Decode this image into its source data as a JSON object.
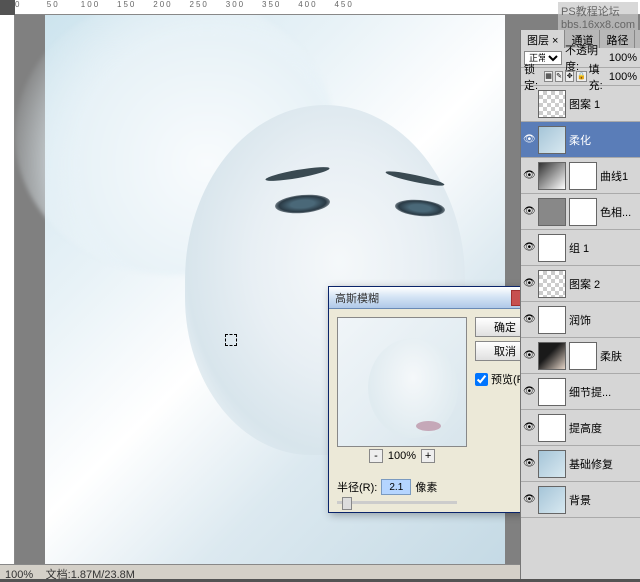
{
  "watermark": {
    "line1": "PS教程论坛",
    "line2": "bbs.16xx8.com"
  },
  "status": {
    "zoom": "100%",
    "doc": "文档:1.87M/23.8M"
  },
  "dialog": {
    "title": "高斯模糊",
    "ok": "确定",
    "cancel": "取消",
    "preview_label": "预览(P)",
    "zoom_minus": "-",
    "zoom_plus": "+",
    "zoom_value": "100%",
    "radius_label": "半径(R):",
    "radius_value": "2.1",
    "radius_unit": "像素"
  },
  "layers": {
    "tabs": {
      "t1": "图层 ×",
      "t2": "通道",
      "t3": "路径"
    },
    "blend": "正常",
    "opacity_label": "不透明度:",
    "opacity": "100%",
    "lock_label": "锁定:",
    "fill_label": "填充:",
    "fill": "100%",
    "items": [
      {
        "name": "图案 1",
        "thumb": "checker",
        "eye": false
      },
      {
        "name": "柔化",
        "thumb": "blue",
        "eye": true,
        "sel": true
      },
      {
        "name": "曲线1",
        "thumb": "grad",
        "mask": true,
        "eye": true
      },
      {
        "name": "色相...",
        "thumb": "gray",
        "mask": true,
        "eye": true
      },
      {
        "name": "组 1",
        "thumb": "",
        "eye": true
      },
      {
        "name": "图案 2",
        "thumb": "checker",
        "eye": true
      },
      {
        "name": "润饰",
        "thumb": "face",
        "mask": true,
        "eye": true
      },
      {
        "name": "柔肤",
        "thumb": "dark",
        "mask": true,
        "eye": true
      },
      {
        "name": "细节提...",
        "thumb": "",
        "eye": true
      },
      {
        "name": "提高度",
        "thumb": "",
        "eye": true
      },
      {
        "name": "基础修复",
        "thumb": "blue",
        "eye": true
      },
      {
        "name": "背景",
        "thumb": "blue",
        "eye": true
      }
    ]
  }
}
